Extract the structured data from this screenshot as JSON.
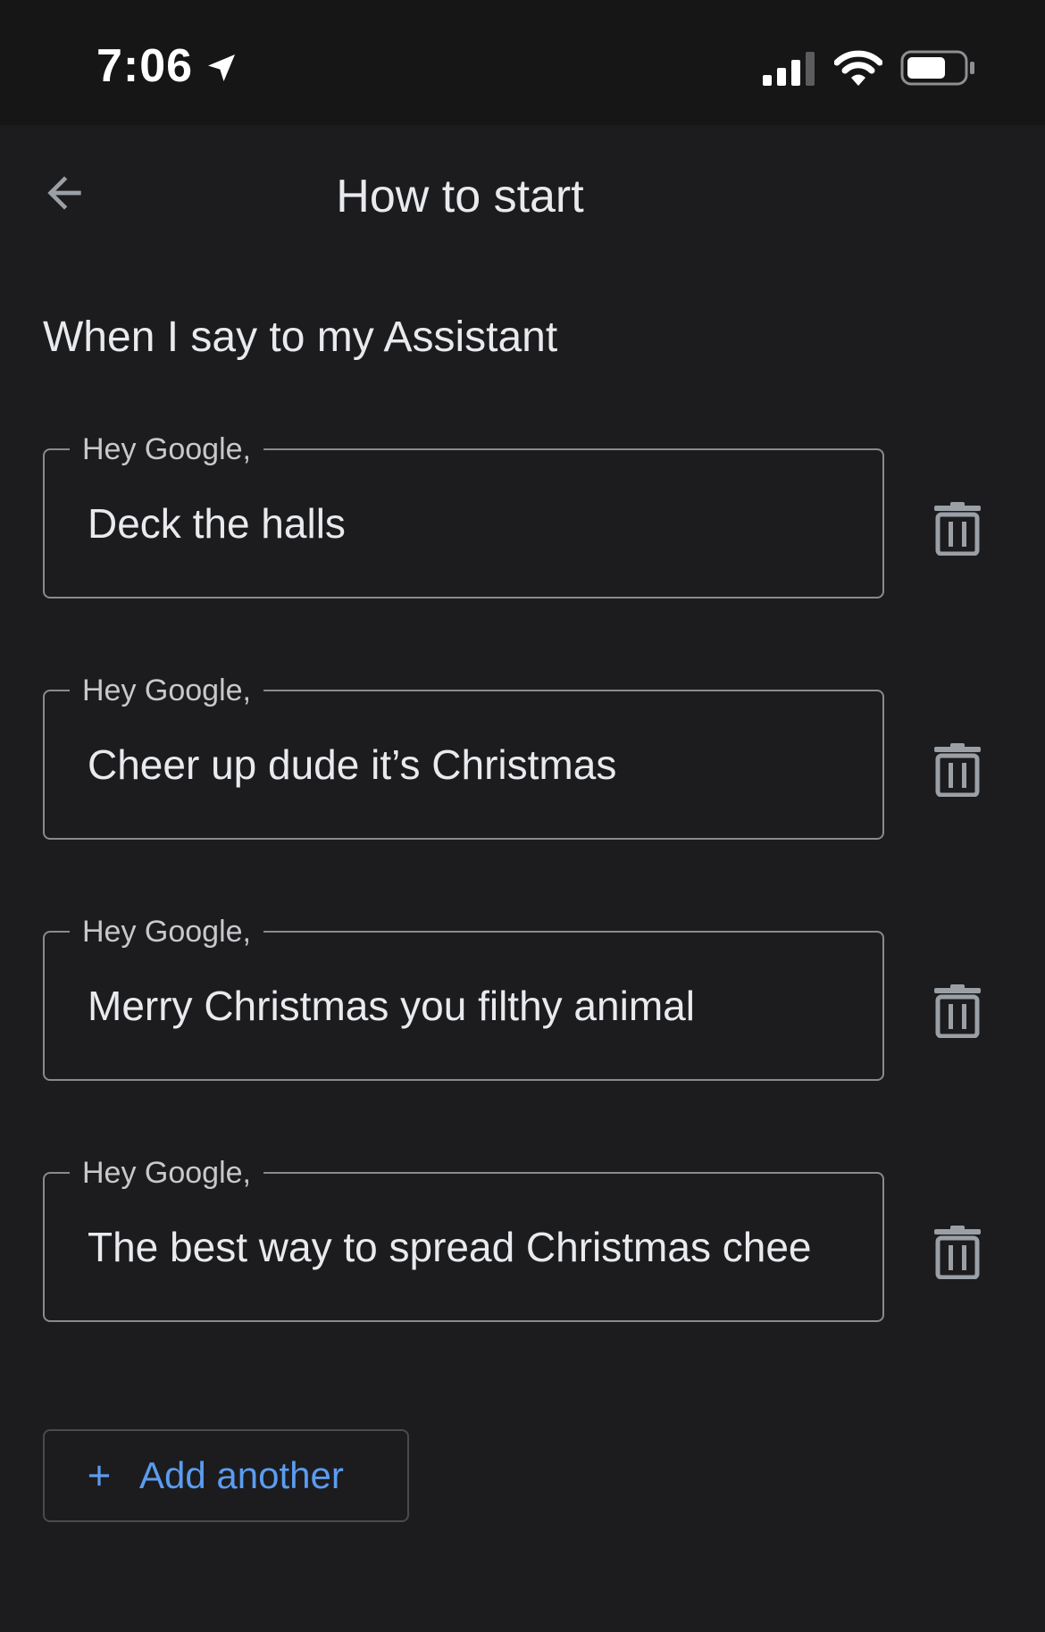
{
  "status_bar": {
    "time": "7:06",
    "icons": [
      "location-arrow-icon",
      "cellular-signal-icon",
      "wifi-icon",
      "battery-icon"
    ]
  },
  "header": {
    "title": "How to start",
    "back_icon": "arrow-back-icon"
  },
  "section": {
    "heading": "When I say to my Assistant"
  },
  "phrases": [
    {
      "label": "Hey Google,",
      "value": "Deck the halls"
    },
    {
      "label": "Hey Google,",
      "value": "Cheer up dude it’s Christmas"
    },
    {
      "label": "Hey Google,",
      "value": "Merry Christmas you filthy animal"
    },
    {
      "label": "Hey Google,",
      "value": "The best way to spread Christmas chee"
    }
  ],
  "delete_icon": "trash-icon",
  "add_button": {
    "label": "Add another",
    "icon": "plus-icon"
  },
  "colors": {
    "background": "#1c1c1e",
    "status_bar": "#161617",
    "accent": "#5b9cf0",
    "border": "#8a8a8d"
  }
}
